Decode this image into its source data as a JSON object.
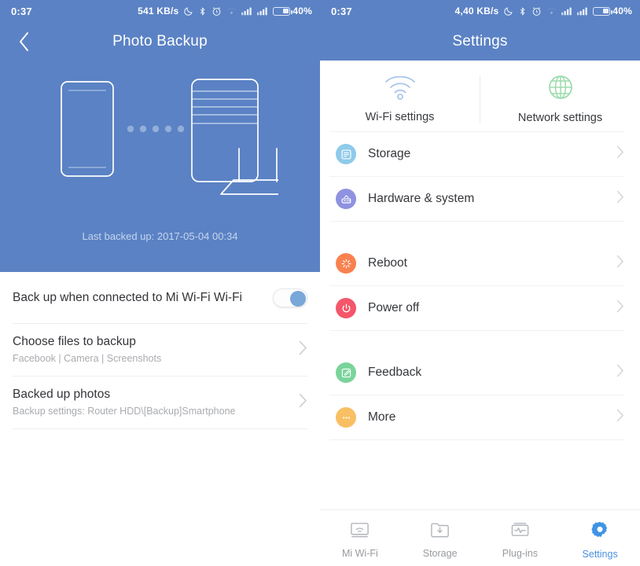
{
  "left": {
    "statusbar": {
      "time": "0:37",
      "net_speed": "541 KB/s",
      "icons": [
        "dnd-moon-icon",
        "bluetooth-icon",
        "alarm-icon",
        "wifi-icon",
        "signal-sim1-icon",
        "signal-sim2-icon"
      ],
      "battery_pct": "40%"
    },
    "header": {
      "title": "Photo Backup",
      "back_icon": "chevron-left-icon"
    },
    "hero": {
      "caption": "Last backed up: 2017-05-04 00:34",
      "art": "phone-to-router-sync-illustration",
      "dot_count": 5
    },
    "rows": [
      {
        "title": "Back up when connected to Mi Wi-Fi Wi-Fi",
        "sub": "",
        "control": "switch",
        "switch_on": true
      },
      {
        "title": "Choose files to backup",
        "sub": "Facebook | Camera | Screenshots",
        "control": "chevron"
      },
      {
        "title": "Backed up photos",
        "sub": "Backup settings: Router HDD\\[Backup]Smartphone",
        "control": "chevron"
      }
    ]
  },
  "right": {
    "statusbar": {
      "time": "0:37",
      "net_speed": "4,40 KB/s",
      "battery_pct": "40%"
    },
    "header": {
      "title": "Settings"
    },
    "shortcuts": [
      {
        "label": "Wi-Fi settings",
        "icon": "wifi-icon",
        "color": "#a9c6e8"
      },
      {
        "label": "Network settings",
        "icon": "globe-icon",
        "color": "#9ddcae"
      }
    ],
    "groups": [
      {
        "items": [
          {
            "label": "Storage",
            "icon": "storage-disk-icon",
            "color": "#8ecaea"
          },
          {
            "label": "Hardware & system",
            "icon": "router-hardware-icon",
            "color": "#8e92e0"
          }
        ]
      },
      {
        "items": [
          {
            "label": "Reboot",
            "icon": "reboot-icon",
            "color": "#f8814f"
          },
          {
            "label": "Power off",
            "icon": "power-off-icon",
            "color": "#f4566a"
          }
        ]
      },
      {
        "items": [
          {
            "label": "Feedback",
            "icon": "feedback-edit-icon",
            "color": "#79d49a"
          },
          {
            "label": "More",
            "icon": "more-dots-icon",
            "color": "#f9bf63"
          }
        ]
      }
    ],
    "tabs": [
      {
        "label": "Mi Wi-Fi",
        "icon": "router-icon",
        "active": false
      },
      {
        "label": "Storage",
        "icon": "folder-download-icon",
        "active": false
      },
      {
        "label": "Plug-ins",
        "icon": "plugins-icon",
        "active": false
      },
      {
        "label": "Settings",
        "icon": "gear-icon",
        "active": true
      }
    ],
    "accent_color": "#4a90e2"
  }
}
